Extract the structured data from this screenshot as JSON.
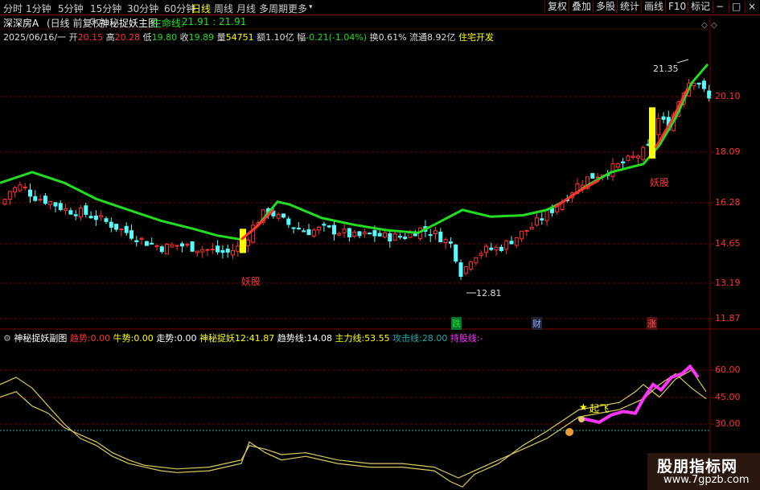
{
  "toolbar": {
    "periods": [
      "分时",
      "1分钟",
      "5分钟",
      "15分钟",
      "30分钟",
      "60分钟",
      "日线",
      "周线",
      "月线",
      "多周期",
      "更多"
    ],
    "more_arrow": "▾",
    "active_period": "日线",
    "buttons": [
      "复权",
      "叠加",
      "多股",
      "统计",
      "画线",
      "F10",
      "标记"
    ],
    "window_buttons": [
      "−",
      "□",
      "×"
    ]
  },
  "header": {
    "stock": "深深房A",
    "mode": "(日线 前复权)",
    "indicator_name": "神秘捉妖主图",
    "life_line_label": "生命线:",
    "life_line_value": "21.91 : 21.91",
    "date": "2025/06/16/一",
    "open_label": "开",
    "open": "20.15",
    "high_label": "高",
    "high": "20.28",
    "low_label": "低",
    "low": "19.80",
    "close_label": "收",
    "close": "19.89",
    "volume_label": "量",
    "volume": "54751",
    "amount_label": "额",
    "amount": "1.10亿",
    "change_label": "幅",
    "change": "-0.21(-1.04%)",
    "turnover_label": "换",
    "turnover": "0.61%",
    "float_label": "流通",
    "float": "8.92亿",
    "sector": "住宅开发"
  },
  "main_axis": {
    "ticks": [
      "20.10",
      "18.09",
      "16.28",
      "14.65",
      "13.19",
      "11.87"
    ]
  },
  "main_annotations": {
    "yao1": "妖股",
    "yao2": "妖股",
    "high_mark": "21.35",
    "low_mark": "12.81",
    "fall": "跌",
    "cai": "财",
    "zhang": "涨"
  },
  "sub": {
    "name": "神秘捉妖副图",
    "trend_label": "趋势:",
    "trend": "0.00",
    "bull_label": "牛势:",
    "bull": "0.00",
    "walk_label": "走势:",
    "walk": "0.00",
    "yao_label": "神秘捉妖12:",
    "yao": "41.87",
    "trendline_label": "趋势线:",
    "trendline": "14.08",
    "main_label": "主力线:",
    "main": "53.55",
    "attack_label": "攻击线:",
    "attack": "28.00",
    "hold_label": "持股线:",
    "hold": "-",
    "ticks": [
      "60.00",
      "45.00",
      "30.00"
    ],
    "takeoff": "起飞"
  },
  "watermark": {
    "line1": "股朋指标网",
    "line2": "www.7gpzb.com"
  },
  "colors": {
    "up": "#ff3232",
    "down": "#54ffff",
    "life_line": "#22dd22",
    "yellow_signal": "#ffff00",
    "magenta": "#ff33ff",
    "sub_line": "#d9c95a",
    "grid": "#7a0000",
    "attack": "#22aaaa"
  }
}
